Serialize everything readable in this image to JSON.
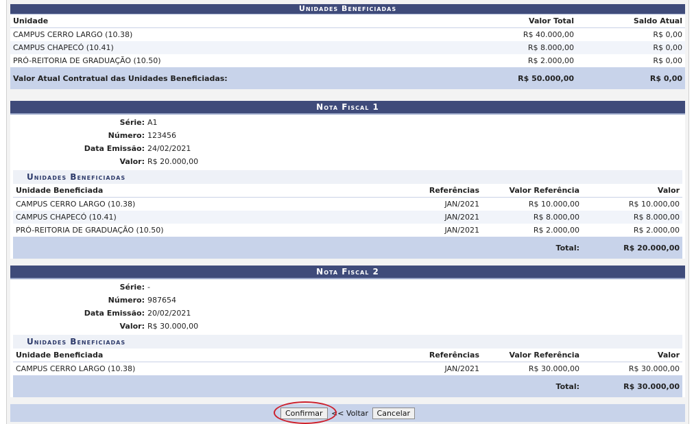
{
  "unidades_section": {
    "title": "Unidades Beneficiadas",
    "headers": {
      "unidade": "Unidade",
      "valor_total": "Valor Total",
      "saldo_atual": "Saldo Atual"
    },
    "rows": [
      {
        "unidade": "CAMPUS CERRO LARGO (10.38)",
        "valor_total": "R$ 40.000,00",
        "saldo_atual": "R$ 0,00"
      },
      {
        "unidade": "CAMPUS CHAPECÓ (10.41)",
        "valor_total": "R$ 8.000,00",
        "saldo_atual": "R$ 0,00"
      },
      {
        "unidade": "PRÓ-REITORIA DE GRADUAÇÃO (10.50)",
        "valor_total": "R$ 2.000,00",
        "saldo_atual": "R$ 0,00"
      }
    ],
    "footer": {
      "label": "Valor Atual Contratual das Unidades Beneficiadas:",
      "valor_total": "R$ 50.000,00",
      "saldo_atual": "R$ 0,00"
    }
  },
  "notas": [
    {
      "title": "Nota Fiscal 1",
      "fields": [
        {
          "label": "Série:",
          "value": "A1"
        },
        {
          "label": "Número:",
          "value": "123456"
        },
        {
          "label": "Data Emissão:",
          "value": "24/02/2021"
        },
        {
          "label": "Valor:",
          "value": "R$ 20.000,00"
        }
      ],
      "subtitle": "Unidades Beneficiadas",
      "headers": {
        "unidade": "Unidade Beneficiada",
        "referencias": "Referências",
        "valor_referencia": "Valor Referência",
        "valor": "Valor"
      },
      "rows": [
        {
          "unidade": "CAMPUS CERRO LARGO (10.38)",
          "referencias": "JAN/2021",
          "valor_referencia": "R$ 10.000,00",
          "valor": "R$ 10.000,00"
        },
        {
          "unidade": "CAMPUS CHAPECÓ (10.41)",
          "referencias": "JAN/2021",
          "valor_referencia": "R$ 8.000,00",
          "valor": "R$ 8.000,00"
        },
        {
          "unidade": "PRÓ-REITORIA DE GRADUAÇÃO (10.50)",
          "referencias": "JAN/2021",
          "valor_referencia": "R$ 2.000,00",
          "valor": "R$ 2.000,00"
        }
      ],
      "total_label": "Total:",
      "total_value": "R$ 20.000,00"
    },
    {
      "title": "Nota Fiscal 2",
      "fields": [
        {
          "label": "Série:",
          "value": "-"
        },
        {
          "label": "Número:",
          "value": "987654"
        },
        {
          "label": "Data Emissão:",
          "value": "20/02/2021"
        },
        {
          "label": "Valor:",
          "value": "R$ 30.000,00"
        }
      ],
      "subtitle": "Unidades Beneficiadas",
      "headers": {
        "unidade": "Unidade Beneficiada",
        "referencias": "Referências",
        "valor_referencia": "Valor Referência",
        "valor": "Valor"
      },
      "rows": [
        {
          "unidade": "CAMPUS CERRO LARGO (10.38)",
          "referencias": "JAN/2021",
          "valor_referencia": "R$ 30.000,00",
          "valor": "R$ 30.000,00"
        }
      ],
      "total_label": "Total:",
      "total_value": "R$ 30.000,00"
    }
  ],
  "buttons": {
    "confirmar": "Confirmar",
    "voltar": "<< Voltar",
    "cancelar": "Cancelar"
  },
  "colors": {
    "header_bg": "#3f4b7a",
    "footer_bg": "#c8d3ea",
    "highlight_circle": "#cc1f2b"
  }
}
